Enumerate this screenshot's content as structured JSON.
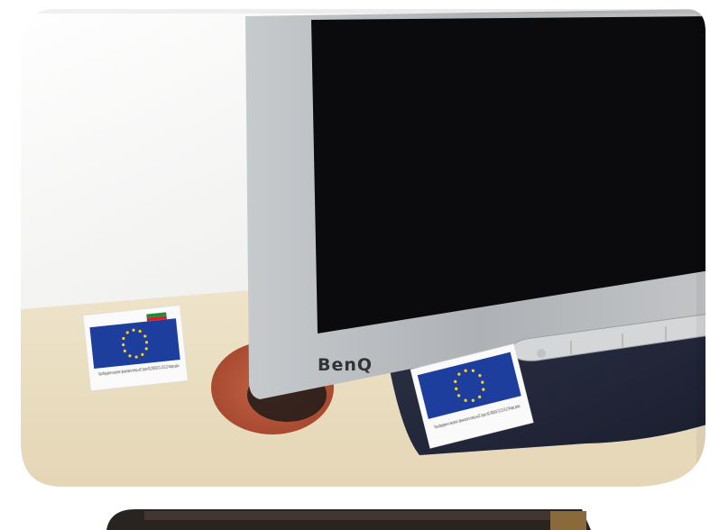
{
  "photo": {
    "monitor_brand": "BenQ",
    "sticker_text_left": "Това оборудване е закупено с финансовата помощ на ЕС проект BG 2004/016-711.01.01-12 Фларес район",
    "sticker_text_right": "Това оборудване е закупено с финансовата помощ на ЕС проект BG 2004/016-711.01.01-12 Фларес район"
  },
  "colors": {
    "frame": "#ffffff",
    "wall": "#f1f1ee",
    "desk": "#eadfc4",
    "bezel": "#b5b8bc",
    "screen": "#0b0b0d",
    "stand": "#23283b",
    "grommet": "#b8553a",
    "eu_blue": "#1d3e9c",
    "eu_star": "#f4d21f"
  }
}
